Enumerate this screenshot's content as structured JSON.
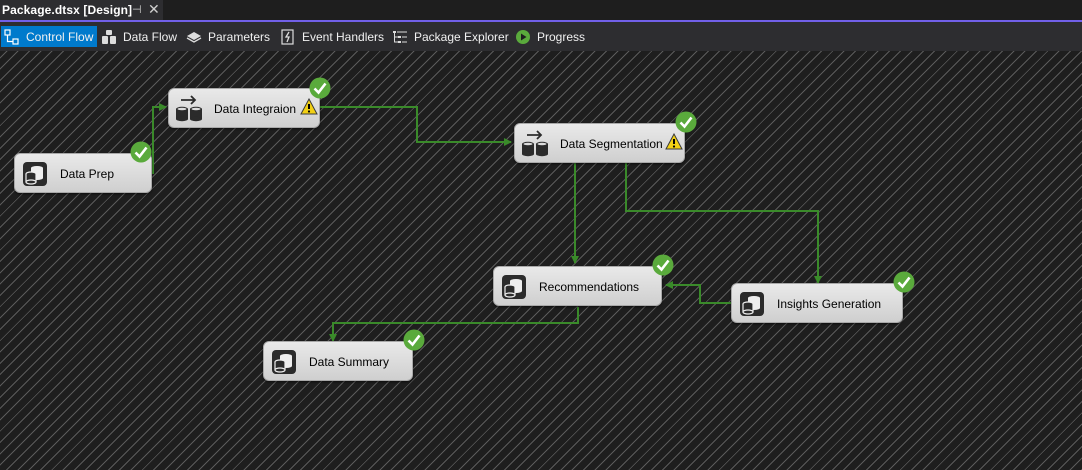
{
  "document_tab": {
    "title": "Package.dtsx [Design]",
    "pin_glyph": "⊣",
    "close_glyph": "✕"
  },
  "designer_tabs": [
    {
      "label": "Control Flow",
      "icon": "control-flow-icon",
      "active": true
    },
    {
      "label": "Data Flow",
      "icon": "data-flow-icon",
      "active": false
    },
    {
      "label": "Parameters",
      "icon": "parameters-icon",
      "active": false
    },
    {
      "label": "Event Handlers",
      "icon": "event-handlers-icon",
      "active": false
    },
    {
      "label": "Package Explorer",
      "icon": "package-explorer-icon",
      "active": false
    },
    {
      "label": "Progress",
      "icon": "progress-play-icon",
      "active": false
    }
  ],
  "tasks": {
    "data_prep": {
      "label": "Data Prep",
      "type": "execute-sql-task",
      "status": "success",
      "warning": false
    },
    "data_integration": {
      "label": "Data Integraion",
      "type": "data-flow-task",
      "status": "success",
      "warning": true
    },
    "data_segmentation": {
      "label": "Data Segmentation",
      "type": "data-flow-task",
      "status": "success",
      "warning": true
    },
    "recommendations": {
      "label": "Recommendations",
      "type": "execute-sql-task",
      "status": "success",
      "warning": false
    },
    "insights_generation": {
      "label": "Insights Generation",
      "type": "execute-sql-task",
      "status": "success",
      "warning": false
    },
    "data_summary": {
      "label": "Data Summary",
      "type": "execute-sql-task",
      "status": "success",
      "warning": false
    }
  },
  "precedence_constraints": [
    {
      "from": "Data Prep",
      "to": "Data Integraion"
    },
    {
      "from": "Data Integraion",
      "to": "Data Segmentation"
    },
    {
      "from": "Data Segmentation",
      "to": "Recommendations"
    },
    {
      "from": "Data Segmentation",
      "to": "Insights Generation"
    },
    {
      "from": "Insights Generation",
      "to": "Recommendations"
    },
    {
      "from": "Recommendations",
      "to": "Data Summary"
    }
  ],
  "colors": {
    "accent": "#7160e8",
    "active_tab": "#007acc",
    "success_green": "#5aaa3c",
    "constraint_green": "#3a8a2a",
    "warning_yellow": "#f2d014"
  }
}
